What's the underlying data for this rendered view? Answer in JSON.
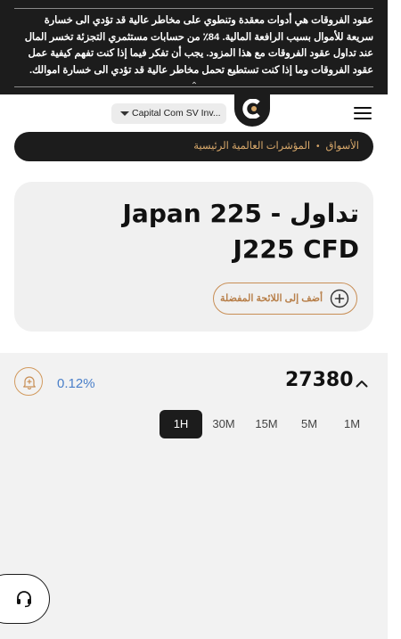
{
  "risk_banner": {
    "text": "عقود الفروقات هي أدوات معقدة وتنطوي على مخاطر عالية قد تؤدي الى خسارة سريعة للأموال بسبب الرافعة المالية. 84٪ من حسابات مستثمري التجزئة تخسر المال عند تداول عقود الفروقات مع هذا المزود. يجب أن تفكر فيما إذا كنت تفهم كيفية عمل عقود الفروقات وما إذا كنت تستطيع تحمل مخاطر عالية قد تؤدي الى خسارة اموالك.",
    "collapse_icon": "double-chevron-up-icon"
  },
  "header": {
    "entity_select_value": "Capital Com SV Inv...",
    "logo_icon": "capital-com-logo-icon",
    "menu_icon": "hamburger-menu-icon"
  },
  "breadcrumb": {
    "items": [
      "الأسواق",
      "المؤشرات العالمية الرئيسية"
    ],
    "separator": "•"
  },
  "instrument": {
    "title": "تداول Japan 225 - J225 CFD",
    "favorite_label": "أضف إلى اللائحة المفضلة",
    "favorite_icon": "plus-circle-icon"
  },
  "quote": {
    "price": "27380",
    "change": "0.12%",
    "alert_icon": "bell-plus-icon",
    "collapse_icon": "chevron-up-icon"
  },
  "timeframes": [
    "1H",
    "30M",
    "15M",
    "5M",
    "1M"
  ],
  "selected_timeframe": "1H",
  "support": {
    "icon": "headset-icon"
  },
  "colors": {
    "banner_bg": "#1c1c1c",
    "accent": "#d9a96b",
    "change_text": "#4a7fc9",
    "card_bg": "#f0f0f0"
  }
}
